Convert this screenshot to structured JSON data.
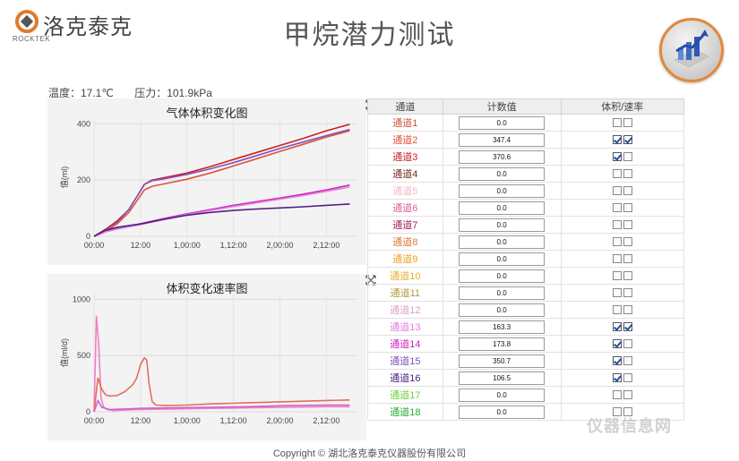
{
  "brand": {
    "name": "洛克泰克",
    "name_en": "ROCKTEK",
    "color": "#e07b2b"
  },
  "page": {
    "title": "甲烷潜力测试"
  },
  "readings": {
    "temperature": "温度：17.1℃",
    "pressure": "压力：101.9kPa"
  },
  "table": {
    "headers": {
      "channel": "通道",
      "count": "计数值",
      "select": "体积/速率"
    },
    "rows": [
      {
        "channel": "通道1",
        "value": "0.0",
        "vol": false,
        "rate": false,
        "color": "#d0533c"
      },
      {
        "channel": "通道2",
        "value": "347.4",
        "vol": true,
        "rate": true,
        "color": "#e0523a"
      },
      {
        "channel": "通道3",
        "value": "370.6",
        "vol": true,
        "rate": false,
        "color": "#cc2020"
      },
      {
        "channel": "通道4",
        "value": "0.0",
        "vol": false,
        "rate": false,
        "color": "#7a2a1a"
      },
      {
        "channel": "通道5",
        "value": "0.0",
        "vol": false,
        "rate": false,
        "color": "#f2b8c8"
      },
      {
        "channel": "通道6",
        "value": "0.0",
        "vol": false,
        "rate": false,
        "color": "#e0609a"
      },
      {
        "channel": "通道7",
        "value": "0.0",
        "vol": false,
        "rate": false,
        "color": "#a02060"
      },
      {
        "channel": "通道8",
        "value": "0.0",
        "vol": false,
        "rate": false,
        "color": "#e07a3a"
      },
      {
        "channel": "通道9",
        "value": "0.0",
        "vol": false,
        "rate": false,
        "color": "#f0a020"
      },
      {
        "channel": "通道10",
        "value": "0.0",
        "vol": false,
        "rate": false,
        "color": "#e8b030"
      },
      {
        "channel": "通道11",
        "value": "0.0",
        "vol": false,
        "rate": false,
        "color": "#b09a40"
      },
      {
        "channel": "通道12",
        "value": "0.0",
        "vol": false,
        "rate": false,
        "color": "#e0a0c8"
      },
      {
        "channel": "通道13",
        "value": "163.3",
        "vol": true,
        "rate": true,
        "color": "#e080e0"
      },
      {
        "channel": "通道14",
        "value": "173.8",
        "vol": true,
        "rate": false,
        "color": "#d020c0"
      },
      {
        "channel": "通道15",
        "value": "350.7",
        "vol": true,
        "rate": false,
        "color": "#8050c0"
      },
      {
        "channel": "通道16",
        "value": "106.5",
        "vol": true,
        "rate": false,
        "color": "#502080"
      },
      {
        "channel": "通道17",
        "value": "0.0",
        "vol": false,
        "rate": false,
        "color": "#70d040"
      },
      {
        "channel": "通道18",
        "value": "0.0",
        "vol": false,
        "rate": false,
        "color": "#20b030"
      }
    ]
  },
  "chart_data": [
    {
      "type": "line",
      "title": "气体体积变化图",
      "ylabel": "值(ml)",
      "xlabel": "",
      "ylim": [
        0,
        420
      ],
      "xlim": [
        0,
        68
      ],
      "yticks": [
        0,
        200,
        400
      ],
      "xticks": [
        {
          "label": "00:00",
          "value": 0
        },
        {
          "label": "12:00",
          "value": 12
        },
        {
          "label": "1,00:00",
          "value": 24
        },
        {
          "label": "1,12:00",
          "value": 36
        },
        {
          "label": "2,00:00",
          "value": 48
        },
        {
          "label": "2,12:00",
          "value": 60
        }
      ],
      "grid": true,
      "series": [
        {
          "color": "#cc2020",
          "x": [
            0,
            3,
            6,
            9,
            11,
            13,
            15,
            18,
            24,
            30,
            36,
            42,
            48,
            54,
            60,
            66
          ],
          "y": [
            0,
            25,
            55,
            95,
            140,
            185,
            200,
            208,
            225,
            248,
            273,
            298,
            323,
            348,
            375,
            398
          ]
        },
        {
          "color": "#8050c0",
          "x": [
            0,
            3,
            6,
            9,
            11,
            13,
            15,
            18,
            24,
            30,
            36,
            42,
            48,
            54,
            60,
            66
          ],
          "y": [
            0,
            22,
            50,
            95,
            140,
            185,
            198,
            204,
            220,
            240,
            262,
            287,
            312,
            335,
            358,
            380
          ]
        },
        {
          "color": "#e0523a",
          "x": [
            0,
            3,
            6,
            9,
            11,
            13,
            15,
            18,
            24,
            30,
            36,
            42,
            48,
            54,
            60,
            66
          ],
          "y": [
            0,
            20,
            45,
            85,
            125,
            165,
            178,
            186,
            203,
            225,
            250,
            276,
            302,
            327,
            353,
            375
          ]
        },
        {
          "color": "#d020c0",
          "x": [
            0,
            3,
            6,
            12,
            18,
            24,
            30,
            36,
            42,
            48,
            54,
            60,
            66
          ],
          "y": [
            0,
            18,
            28,
            45,
            63,
            80,
            95,
            110,
            123,
            136,
            150,
            165,
            182
          ]
        },
        {
          "color": "#e080e0",
          "x": [
            0,
            3,
            6,
            12,
            18,
            24,
            30,
            36,
            42,
            48,
            54,
            60,
            66
          ],
          "y": [
            0,
            16,
            26,
            42,
            60,
            77,
            92,
            106,
            119,
            132,
            145,
            160,
            175
          ]
        },
        {
          "color": "#502080",
          "x": [
            0,
            3,
            6,
            12,
            18,
            24,
            30,
            36,
            42,
            48,
            54,
            60,
            66
          ],
          "y": [
            0,
            22,
            32,
            44,
            60,
            75,
            85,
            92,
            97,
            101,
            105,
            110,
            115
          ]
        }
      ]
    },
    {
      "type": "line",
      "title": "体积变化速率图",
      "ylabel": "值(ml/d)",
      "xlabel": "",
      "ylim": [
        0,
        1050
      ],
      "xlim": [
        0,
        68
      ],
      "yticks": [
        0,
        500,
        1000
      ],
      "xticks": [
        {
          "label": "00:00",
          "value": 0
        },
        {
          "label": "12:00",
          "value": 12
        },
        {
          "label": "1,00:00",
          "value": 24
        },
        {
          "label": "1,12:00",
          "value": 36
        },
        {
          "label": "2,00:00",
          "value": 48
        },
        {
          "label": "2,12:00",
          "value": 60
        }
      ],
      "grid": true,
      "series": [
        {
          "color": "#f080c0",
          "x": [
            0,
            0.6,
            1.2,
            1.8,
            2.5,
            3.5,
            5,
            8,
            12,
            20,
            30,
            40,
            50,
            60,
            66
          ],
          "y": [
            0,
            850,
            600,
            120,
            40,
            20,
            10,
            15,
            20,
            25,
            30,
            35,
            40,
            45,
            45
          ]
        },
        {
          "color": "#e0705a",
          "x": [
            0,
            1,
            2,
            3,
            4,
            6,
            8,
            10,
            11,
            12,
            13,
            13.6,
            14.2,
            15,
            16,
            18,
            24,
            30,
            40,
            50,
            60,
            66
          ],
          "y": [
            0,
            300,
            200,
            150,
            140,
            145,
            180,
            240,
            300,
            420,
            480,
            460,
            250,
            90,
            60,
            55,
            60,
            70,
            80,
            90,
            100,
            105
          ]
        },
        {
          "color": "#d060d0",
          "x": [
            0,
            1,
            2,
            4,
            8,
            12,
            20,
            30,
            40,
            50,
            60,
            66
          ],
          "y": [
            0,
            100,
            40,
            20,
            25,
            30,
            35,
            40,
            45,
            55,
            60,
            60
          ]
        }
      ]
    }
  ],
  "footer": {
    "copyright": "Copyright © 湖北洛克泰克仪器股份有限公司"
  },
  "watermark": {
    "text": "仪器信息网"
  }
}
